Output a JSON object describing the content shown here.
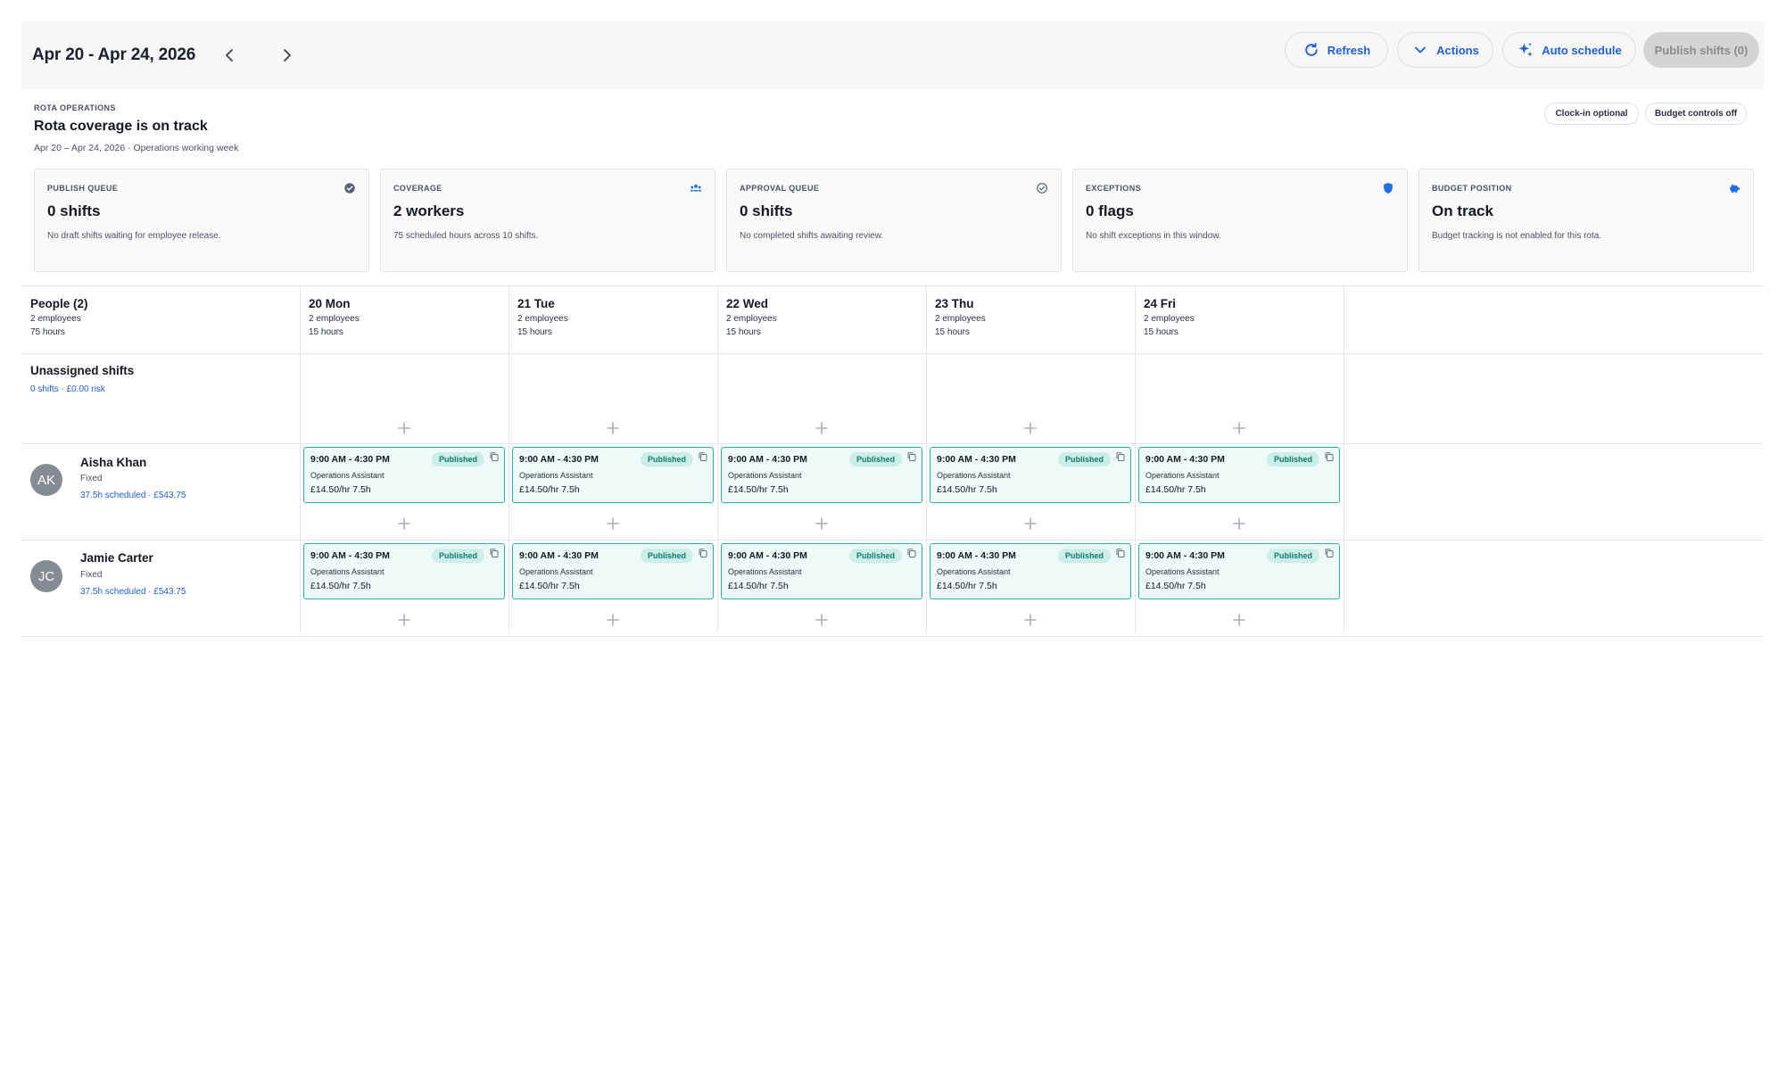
{
  "topbar": {
    "date_range": "Apr 20 - Apr 24, 2026",
    "refresh_label": "Refresh",
    "actions_label": "Actions",
    "auto_schedule_label": "Auto schedule",
    "publish_label": "Publish shifts (0)"
  },
  "summary": {
    "eyebrow": "ROTA OPERATIONS",
    "headline": "Rota coverage is on track",
    "subline": "Apr 20 – Apr 24, 2026  ·  Operations working week",
    "pills": [
      "Clock-in optional",
      "Budget controls off"
    ]
  },
  "kpis": [
    {
      "label": "PUBLISH QUEUE",
      "value": "0 shifts",
      "desc": "No draft shifts waiting for employee release.",
      "icon": "check-badge-icon",
      "color": "#5a6272"
    },
    {
      "label": "COVERAGE",
      "value": "2 workers",
      "desc": "75 scheduled hours across 10 shifts.",
      "icon": "people-icon",
      "color": "#1f6fe0"
    },
    {
      "label": "APPROVAL QUEUE",
      "value": "0 shifts",
      "desc": "No completed shifts awaiting review.",
      "icon": "check-circle-icon",
      "color": "#5a6272"
    },
    {
      "label": "EXCEPTIONS",
      "value": "0 flags",
      "desc": "No shift exceptions in this window.",
      "icon": "shield-icon",
      "color": "#1f6fe0"
    },
    {
      "label": "BUDGET POSITION",
      "value": "On track",
      "desc": "Budget tracking is not enabled for this rota.",
      "icon": "piggy-bank-icon",
      "color": "#1f6fe0"
    }
  ],
  "grid": {
    "people_header": {
      "title": "People (2)",
      "line1": "2 employees",
      "line2": "75 hours"
    },
    "days": [
      {
        "title": "20 Mon",
        "line1": "2 employees",
        "line2": "15 hours"
      },
      {
        "title": "21 Tue",
        "line1": "2 employees",
        "line2": "15 hours"
      },
      {
        "title": "22 Wed",
        "line1": "2 employees",
        "line2": "15 hours"
      },
      {
        "title": "23 Thu",
        "line1": "2 employees",
        "line2": "15 hours"
      },
      {
        "title": "24 Fri",
        "line1": "2 employees",
        "line2": "15 hours"
      }
    ],
    "unassigned": {
      "title": "Unassigned shifts",
      "sub": "0 shifts  ·  £0.00 risk"
    },
    "employees": [
      {
        "initials": "AK",
        "name": "Aisha Khan",
        "type": "Fixed",
        "meta": "37.5h scheduled  ·  £543.75",
        "shifts": [
          {
            "time": "9:00 AM - 4:30 PM",
            "status": "Published",
            "role": "Operations Assistant",
            "rate": "£14.50/hr 7.5h"
          },
          {
            "time": "9:00 AM - 4:30 PM",
            "status": "Published",
            "role": "Operations Assistant",
            "rate": "£14.50/hr 7.5h"
          },
          {
            "time": "9:00 AM - 4:30 PM",
            "status": "Published",
            "role": "Operations Assistant",
            "rate": "£14.50/hr 7.5h"
          },
          {
            "time": "9:00 AM - 4:30 PM",
            "status": "Published",
            "role": "Operations Assistant",
            "rate": "£14.50/hr 7.5h"
          },
          {
            "time": "9:00 AM - 4:30 PM",
            "status": "Published",
            "role": "Operations Assistant",
            "rate": "£14.50/hr 7.5h"
          }
        ]
      },
      {
        "initials": "JC",
        "name": "Jamie Carter",
        "type": "Fixed",
        "meta": "37.5h scheduled  ·  £543.75",
        "shifts": [
          {
            "time": "9:00 AM - 4:30 PM",
            "status": "Published",
            "role": "Operations Assistant",
            "rate": "£14.50/hr 7.5h"
          },
          {
            "time": "9:00 AM - 4:30 PM",
            "status": "Published",
            "role": "Operations Assistant",
            "rate": "£14.50/hr 7.5h"
          },
          {
            "time": "9:00 AM - 4:30 PM",
            "status": "Published",
            "role": "Operations Assistant",
            "rate": "£14.50/hr 7.5h"
          },
          {
            "time": "9:00 AM - 4:30 PM",
            "status": "Published",
            "role": "Operations Assistant",
            "rate": "£14.50/hr 7.5h"
          },
          {
            "time": "9:00 AM - 4:30 PM",
            "status": "Published",
            "role": "Operations Assistant",
            "rate": "£14.50/hr 7.5h"
          }
        ]
      }
    ]
  }
}
